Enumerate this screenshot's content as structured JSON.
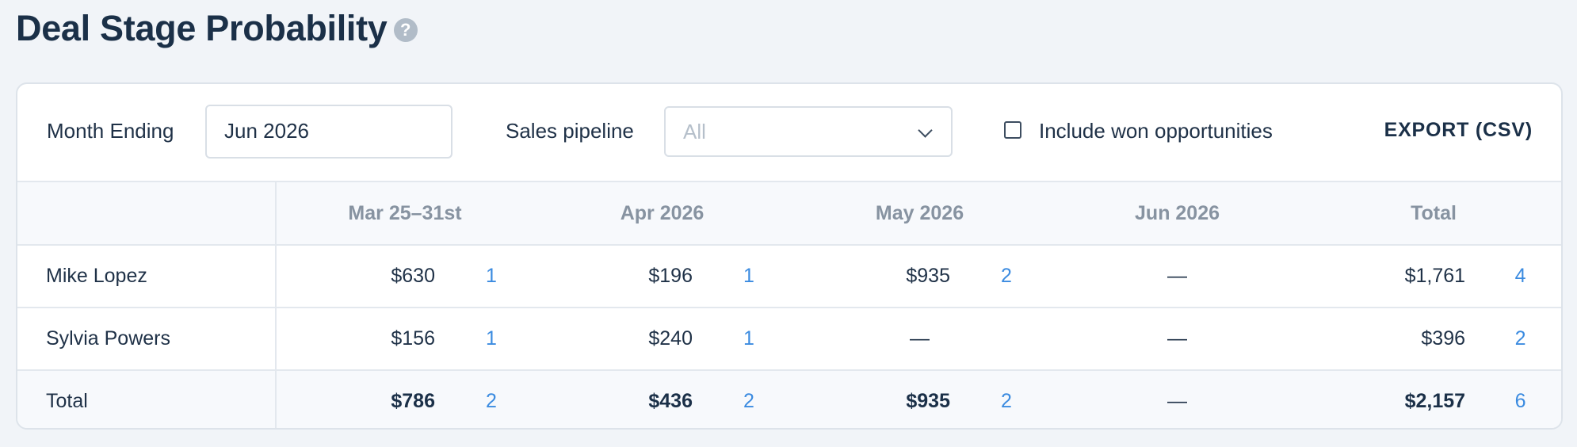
{
  "page": {
    "title": "Deal Stage Probability",
    "help_icon": "question-circle-icon",
    "help_glyph": "?"
  },
  "toolbar": {
    "month_label": "Month Ending",
    "month_value": "Jun 2026",
    "pipeline_label": "Sales pipeline",
    "pipeline_value": "All",
    "include_won_label": "Include won opportunities",
    "include_won_checked": false,
    "export_label": "EXPORT (CSV)"
  },
  "table": {
    "columns": [
      "Mar 25–31st",
      "Apr 2026",
      "May 2026",
      "Jun 2026",
      "Total"
    ],
    "rows": [
      {
        "name": "Mike Lopez",
        "cells": [
          {
            "amount": "$630",
            "count": "1"
          },
          {
            "amount": "$196",
            "count": "1"
          },
          {
            "amount": "$935",
            "count": "2"
          },
          {
            "amount": "—",
            "count": ""
          },
          {
            "amount": "$1,761",
            "count": "4"
          }
        ]
      },
      {
        "name": "Sylvia Powers",
        "cells": [
          {
            "amount": "$156",
            "count": "1"
          },
          {
            "amount": "$240",
            "count": "1"
          },
          {
            "amount": "—",
            "count": ""
          },
          {
            "amount": "—",
            "count": ""
          },
          {
            "amount": "$396",
            "count": "2"
          }
        ]
      },
      {
        "name": "Total",
        "cells": [
          {
            "amount": "$786",
            "count": "2"
          },
          {
            "amount": "$436",
            "count": "2"
          },
          {
            "amount": "$935",
            "count": "2"
          },
          {
            "amount": "—",
            "count": ""
          },
          {
            "amount": "$2,157",
            "count": "6"
          }
        ]
      }
    ]
  },
  "colors": {
    "background": "#f1f4f8",
    "title": "#1b3048",
    "count_link": "#3b8be0",
    "header_text": "#8793a1"
  }
}
